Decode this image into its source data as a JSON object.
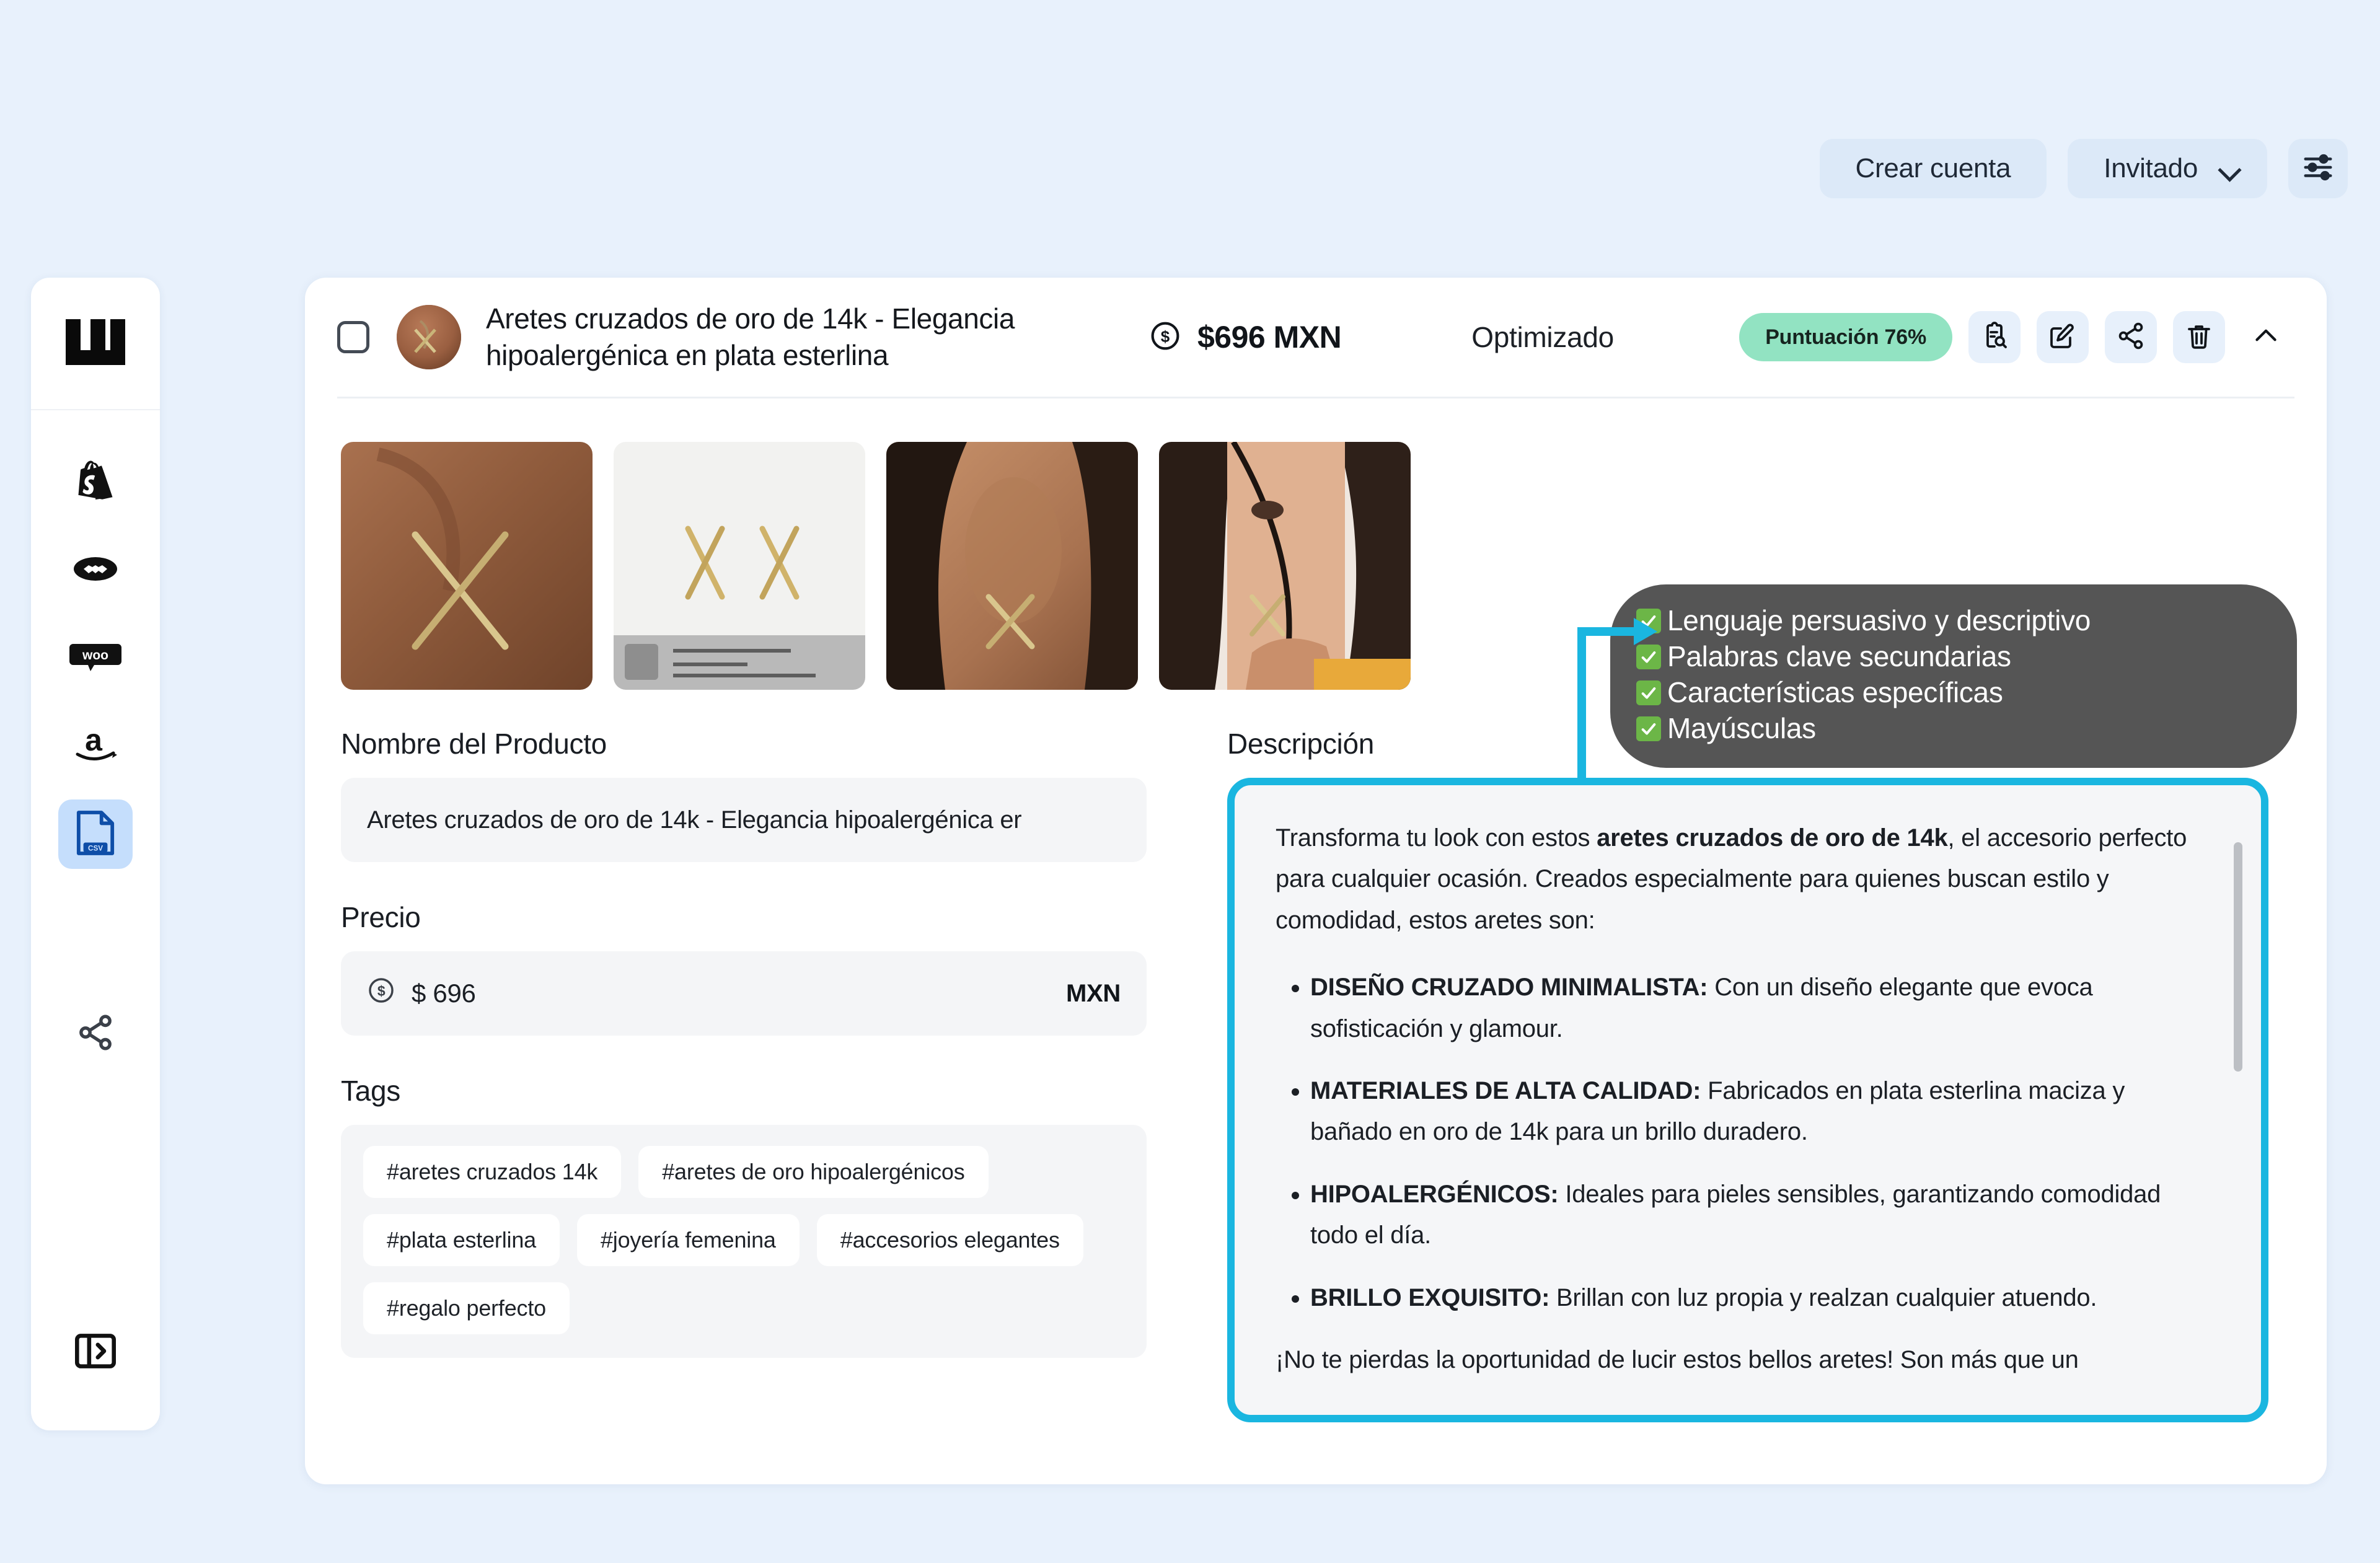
{
  "topbar": {
    "create_account_label": "Crear cuenta",
    "guest_label": "Invitado",
    "settings_icon": "sliders-icon",
    "chevron_icon": "chevron-down-icon"
  },
  "sidebar": {
    "logo_name": "nu-logo",
    "items": [
      {
        "name": "sidebar-item-shopify",
        "icon": "shopify-icon",
        "active": false
      },
      {
        "name": "sidebar-item-handshake",
        "icon": "handshake-icon",
        "active": false
      },
      {
        "name": "sidebar-item-woocommerce",
        "icon": "woocommerce-icon",
        "active": false
      },
      {
        "name": "sidebar-item-amazon",
        "icon": "amazon-icon",
        "active": false
      },
      {
        "name": "sidebar-item-csv",
        "icon": "csv-file-icon",
        "active": true
      }
    ],
    "share_icon": "share-icon",
    "collapse_icon": "panel-toggle-icon"
  },
  "product_card": {
    "checkbox_checked": false,
    "avatar_name": "product-avatar",
    "title": "Aretes cruzados de oro de 14k - Elegancia hipoalergénica en plata esterlina",
    "price_display": "$696 MXN",
    "price_icon": "dollar-circle-icon",
    "status": "Optimizado",
    "score_badge": "Puntuación 76%",
    "actions": [
      {
        "name": "analyze-icon",
        "label": "clipboard-search-icon"
      },
      {
        "name": "edit-icon",
        "label": "pencil-square-icon"
      },
      {
        "name": "share-icon",
        "label": "share-nodes-icon"
      },
      {
        "name": "delete-icon",
        "label": "trash-icon"
      },
      {
        "name": "collapse-caret-icon",
        "label": "chevron-up-icon"
      }
    ],
    "gallery": [
      {
        "name": "gallery-thumb-1",
        "alt": "Oreja con arete cruzado dorado"
      },
      {
        "name": "gallery-thumb-2",
        "alt": "Par de aretes cruzados sobre fondo blanco con especificaciones"
      },
      {
        "name": "gallery-thumb-3",
        "alt": "Modelo mostrando arete cruzado en oreja"
      },
      {
        "name": "gallery-thumb-4",
        "alt": "Modelo de perfil con arete cruzado"
      }
    ]
  },
  "fields": {
    "name_label": "Nombre del Producto",
    "name_value": "Aretes cruzados de oro de 14k - Elegancia hipoalergénica er",
    "price_label": "Precio",
    "price_value": "$ 696",
    "currency": "MXN",
    "tags_label": "Tags",
    "tags": [
      "#aretes cruzados 14k",
      "#aretes de oro hipoalergénicos",
      "#plata esterlina",
      "#joyería femenina",
      "#accesorios elegantes",
      "#regalo perfecto"
    ]
  },
  "description": {
    "label": "Descripción",
    "intro_before_bold": "Transforma tu look con estos ",
    "intro_bold": "aretes cruzados de oro de 14k",
    "intro_after_bold": ", el accesorio perfecto para cualquier ocasión. Creados especialmente para quienes buscan estilo y comodidad, estos aretes son:",
    "bullets": [
      {
        "title": "DISEÑO CRUZADO MINIMALISTA:",
        "text": " Con un diseño elegante que evoca sofisticación y glamour."
      },
      {
        "title": "MATERIALES DE ALTA CALIDAD:",
        "text": " Fabricados en plata esterlina maciza y bañado en oro de 14k para un brillo duradero."
      },
      {
        "title": "HIPOALERGÉNICOS:",
        "text": " Ideales para pieles sensibles, garantizando comodidad todo el día."
      },
      {
        "title": "BRILLO EXQUISITO:",
        "text": " Brillan con luz propia y realzan cualquier atuendo."
      }
    ],
    "closing": "¡No te pierdas la oportunidad de lucir estos bellos aretes! Son más que un"
  },
  "tooltip": {
    "items": [
      "Lenguaje persuasivo y descriptivo",
      "Palabras clave secundarias",
      "Características específicas",
      "Mayúsculas"
    ]
  },
  "colors": {
    "page_bg": "#e8f1fc",
    "accent_highlight": "#1ab6e0",
    "badge_green": "#92e3c2",
    "tooltip_bg": "#555555",
    "check_green": "#6cb647",
    "pill_bg": "#dce9f8"
  }
}
